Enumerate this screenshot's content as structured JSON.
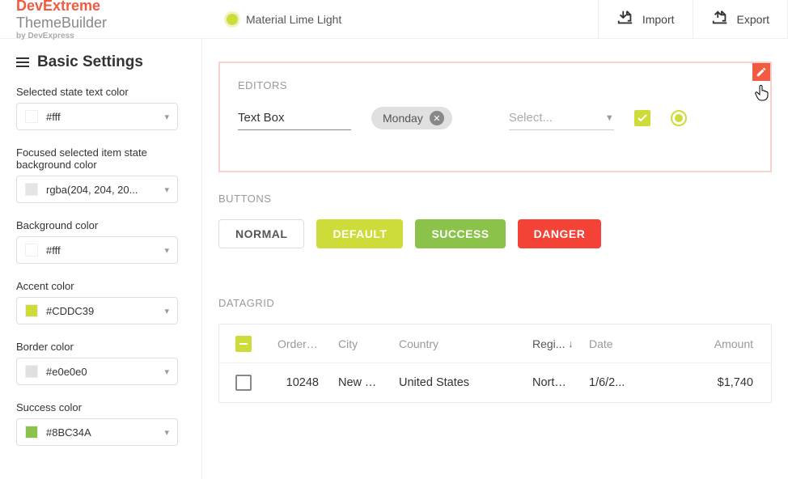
{
  "brand": {
    "part1": "DevExtreme",
    "part2": " ThemeBuilder",
    "sub": "by DevExpress"
  },
  "theme": {
    "name": "Material Lime Light"
  },
  "topbar": {
    "import": "Import",
    "export": "Export"
  },
  "sidebar": {
    "title": "Basic Settings",
    "fields": [
      {
        "label": "Selected state text color",
        "value": "#fff",
        "swatch": "#ffffff"
      },
      {
        "label": "Focused selected item state background color",
        "value": "rgba(204, 204, 20...",
        "swatch": "#e5e5e5"
      },
      {
        "label": "Background color",
        "value": "#fff",
        "swatch": "#ffffff"
      },
      {
        "label": "Accent color",
        "value": "#CDDC39",
        "swatch": "#CDDC39"
      },
      {
        "label": "Border color",
        "value": "#e0e0e0",
        "swatch": "#e0e0e0"
      },
      {
        "label": "Success color",
        "value": "#8BC34A",
        "swatch": "#8BC34A"
      }
    ]
  },
  "editors": {
    "title": "EDITORS",
    "textbox_value": "Text Box",
    "tag_label": "Monday",
    "select_placeholder": "Select..."
  },
  "buttons": {
    "title": "BUTTONS",
    "normal": "NORMAL",
    "default": "DEFAULT",
    "success": "SUCCESS",
    "danger": "DANGER"
  },
  "grid": {
    "title": "DATAGRID",
    "columns": {
      "order": "Order ID",
      "city": "City",
      "country": "Country",
      "region": "Regi...",
      "date": "Date",
      "amount": "Amount"
    },
    "rows": [
      {
        "order": "10248",
        "city": "New Y...",
        "country": "United States",
        "region": "North ...",
        "date": "1/6/2...",
        "amount": "$1,740"
      }
    ]
  }
}
